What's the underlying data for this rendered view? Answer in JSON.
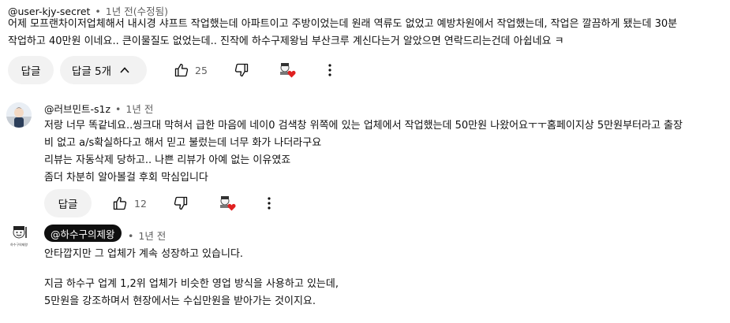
{
  "comments": [
    {
      "author": "@user-kjy-secret",
      "time": "1년 전(수정됨)",
      "lines": [
        "어제 모프랜차이저업체해서 내시경 샤프트 작업했는데 아파트이고 주방이었는데 원래 역류도 없었고 예방차원에서 작업했는데, 작업은 깔끔하게 됐는데 30분",
        "작업하고 40만원 이네요.. 큰이물질도 없었는데.. 진작에 하수구제왕님 부산크루 계신다는거 알았으면 연락드리는건데 아쉽네요 ㅋ"
      ],
      "reply_label": "답글",
      "replies_toggle": "답글 5개",
      "likes": "25"
    },
    {
      "author": "@러브민트-s1z",
      "time": "1년 전",
      "lines": [
        "저랑 너무 똑같네요..씽크대 막혀서  급한 마음에 네이0 검색창 위쪽에 있는 업체에서 작업했는데 50만원 나왔어요ㅜㅜ홈페이지상 5만원부터라고 출장",
        "비 없고 a/s확실하다고 해서 믿고 불렀는데 너무 화가 나더라구요",
        "리뷰는 자동삭제 당하고.. 나쁜 리뷰가 아예 없는 이유였죠",
        "좀더 차분히 알아볼걸 후회 막심입니다"
      ],
      "reply_label": "답글",
      "likes": "12"
    },
    {
      "author": "@하수구의제왕",
      "time": "1년 전",
      "avatar_text": "하수구의제왕",
      "lines": [
        "안타깝지만 그 업체가 계속 성장하고 있습니다.",
        "",
        "지금 하수구 업계 1,2위 업체가 비슷한 영업 방식을 사용하고 있는데,",
        "5만원을 강조하며서 현장에서는 수십만원을 받아가는 것이지요."
      ]
    }
  ],
  "separator": "•",
  "colors": {
    "heart": "#e02020",
    "pill_bg": "#f2f2f2",
    "channel_pill": "#0f0f0f"
  }
}
